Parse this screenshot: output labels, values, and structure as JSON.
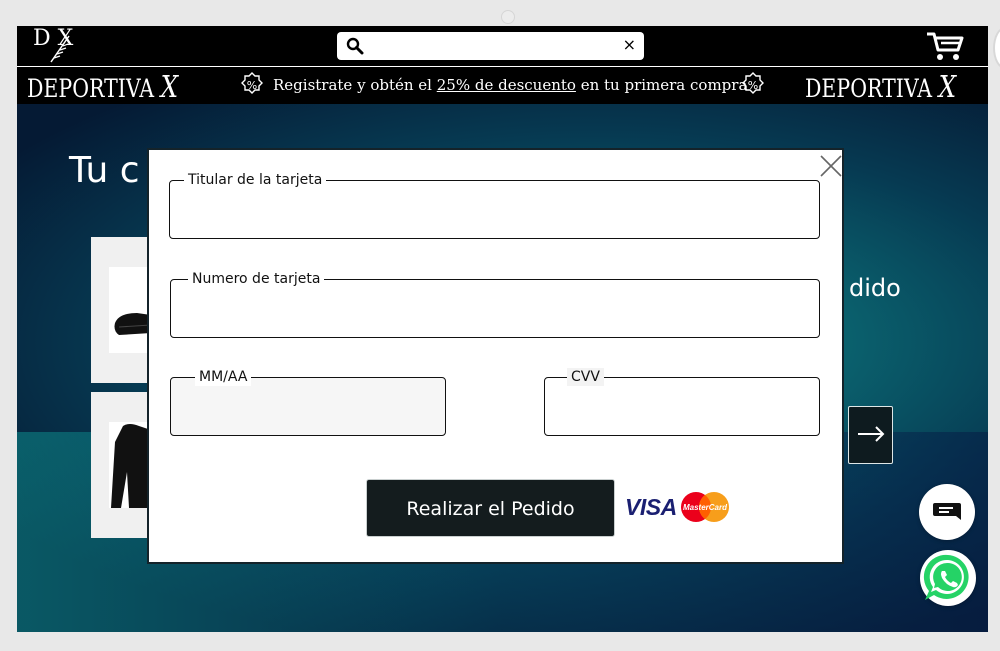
{
  "header": {
    "logo_letters": "D X",
    "search": {
      "value": "",
      "placeholder": "",
      "clear_label": "×"
    }
  },
  "promo": {
    "brand": "DEPORTIVA",
    "brand_mark": "X",
    "text_before": "Registrate y obtén el ",
    "text_link": "25% de descuento",
    "text_after": " en tu primera compra",
    "badge": "%"
  },
  "hero": {
    "title_visible": "Tu c",
    "right_text_visible": "dido"
  },
  "modal": {
    "fields": {
      "holder": {
        "label": "Titular de la tarjeta",
        "value": ""
      },
      "number": {
        "label": "Numero de tarjeta",
        "value": ""
      },
      "expiry": {
        "label": "MM/AA",
        "value": ""
      },
      "cvv": {
        "label": "CVV",
        "value": ""
      }
    },
    "submit_label": "Realizar el Pedido",
    "brands": {
      "visa": "VISA",
      "mastercard": "MasterCard"
    }
  },
  "colors": {
    "topbar": "#000000",
    "submit_bg": "#141c1e",
    "visa_blue": "#1a1f71",
    "mc_red": "#eb001b",
    "mc_orange": "#f79e1b",
    "whatsapp": "#25d366"
  },
  "icons": [
    "search-icon",
    "close-icon",
    "cart-icon",
    "percent-badge-icon",
    "arrow-right-icon",
    "chat-icon",
    "whatsapp-icon",
    "mastercard-logo",
    "visa-logo"
  ]
}
